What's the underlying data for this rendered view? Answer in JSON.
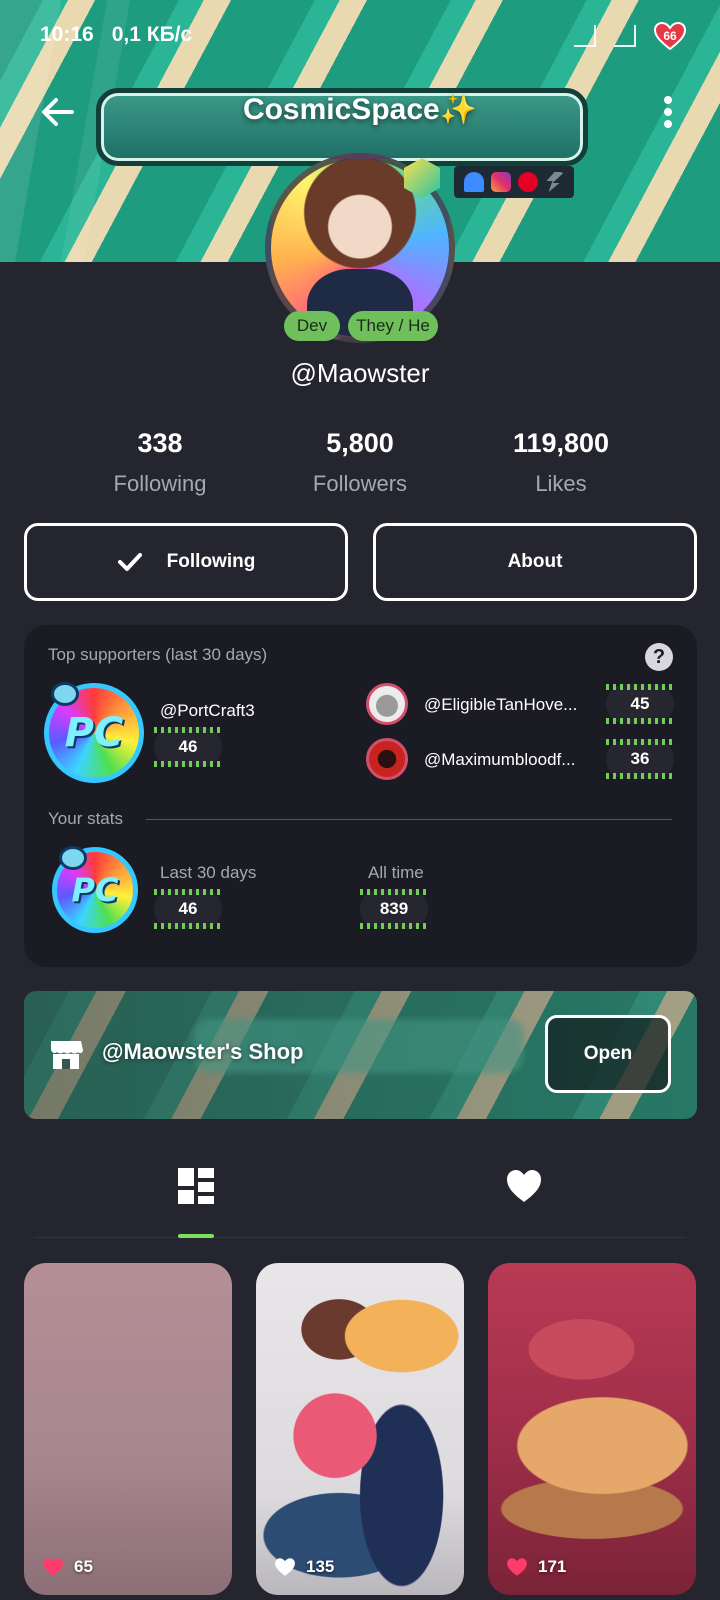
{
  "status_bar": {
    "time": "10:16",
    "speed": "0,1 КБ/с",
    "battery": "66"
  },
  "header": {
    "title": "CosmicSpace",
    "title_emoji": "✨"
  },
  "profile": {
    "handle": "@Maowster",
    "tags": [
      "Dev",
      "They / He"
    ],
    "stats": [
      {
        "value": "338",
        "label": "Following"
      },
      {
        "value": "5,800",
        "label": "Followers"
      },
      {
        "value": "119,800",
        "label": "Likes"
      }
    ],
    "buttons": {
      "following": "Following",
      "about": "About"
    }
  },
  "supporters": {
    "title": "Top supporters (last 30 days)",
    "top": {
      "name": "@PortCraft3",
      "amount": "46"
    },
    "others": [
      {
        "name": "@EligibleTanHove...",
        "amount": "45"
      },
      {
        "name": "@Maximumbloodf...",
        "amount": "36"
      }
    ],
    "your_stats_label": "Your stats",
    "last30_label": "Last 30 days",
    "last30_value": "46",
    "alltime_label": "All time",
    "alltime_value": "839"
  },
  "shop": {
    "label": "@Maowster's Shop",
    "open_label": "Open"
  },
  "tabs": [
    {
      "icon": "grid-layout-icon",
      "active": true
    },
    {
      "icon": "heart-icon",
      "active": false
    }
  ],
  "posts": [
    {
      "likes": "65",
      "heart_color": "#ff3b6b"
    },
    {
      "likes": "135",
      "heart_color": "#ffffff"
    },
    {
      "likes": "171",
      "heart_color": "#ff3b6b"
    }
  ],
  "colors": {
    "background": "#25252f",
    "card": "#1b1b23",
    "accent": "#7be05e",
    "tag": "#6fbf5a",
    "muted_text": "#a7a7b0"
  }
}
